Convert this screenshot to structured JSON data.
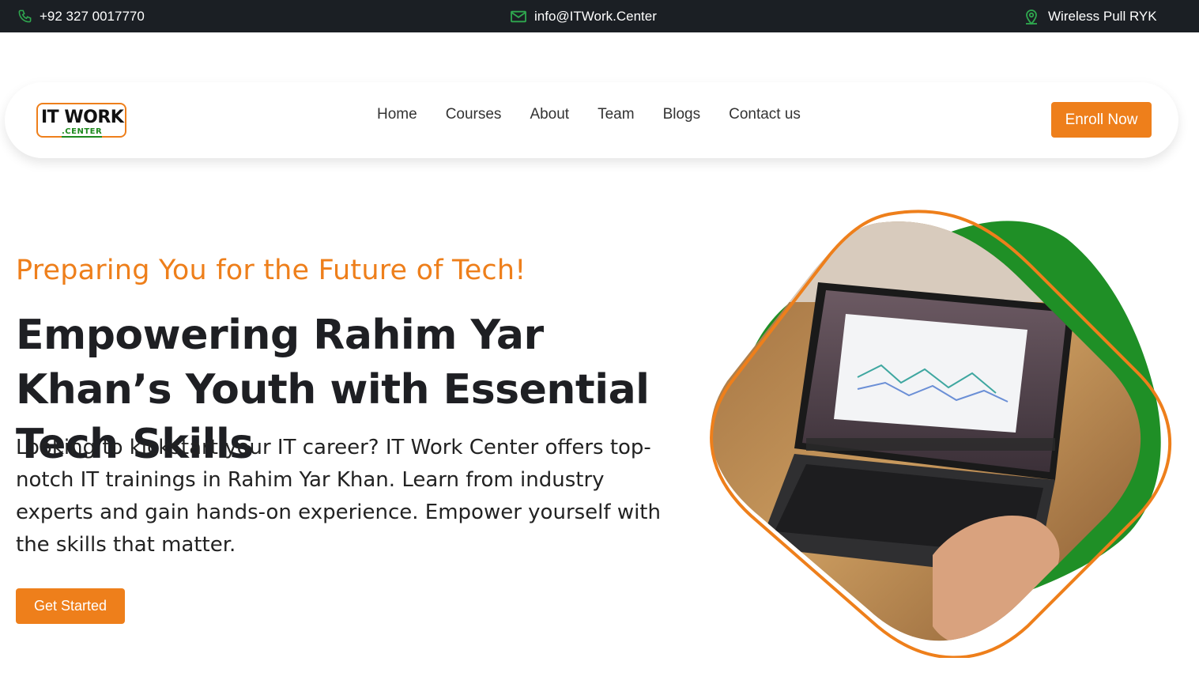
{
  "topbar": {
    "phone": "+92 327 0017770",
    "email": "info@ITWork.Center",
    "location": "Wireless Pull RYK",
    "phone_icon": "phone-icon",
    "email_icon": "mail-icon",
    "location_icon": "map-pin-icon"
  },
  "logo": {
    "line1": "IT WORK",
    "line2": ".CENTER"
  },
  "nav": {
    "items": [
      {
        "label": "Home"
      },
      {
        "label": "Courses"
      },
      {
        "label": "About"
      },
      {
        "label": "Team"
      },
      {
        "label": "Blogs"
      },
      {
        "label": "Contact us"
      }
    ],
    "cta": "Enroll Now"
  },
  "hero": {
    "tagline": "Preparing You for the Future of Tech!",
    "headline": "Empowering Rahim Yar Khan’s Youth with Essential Tech Skills",
    "description": "Looking to kickstart your IT career? IT Work Center offers top-notch IT trainings in Rahim Yar Khan. Learn from industry experts and gain hands-on experience. Empower yourself with the skills that matter.",
    "button": "Get Started"
  },
  "colors": {
    "accent": "#ee7f1b",
    "green": "#1e8a1e",
    "topbar_bg": "#1b1f24"
  }
}
